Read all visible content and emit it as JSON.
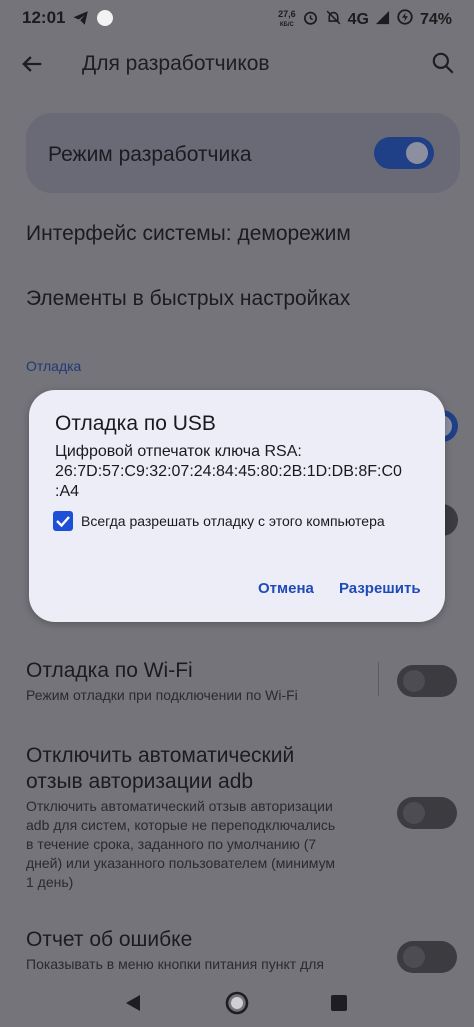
{
  "status_bar": {
    "time": "12:01",
    "speed_value": "27,6",
    "speed_unit": "КБ/С",
    "network": "4G",
    "battery": "74%"
  },
  "header": {
    "title": "Для разработчиков"
  },
  "dev_mode": {
    "label": "Режим разработчика",
    "enabled": true
  },
  "items": {
    "demo_mode": "Интерфейс системы: деморежим",
    "quick_settings": "Элементы в быстрых настройках"
  },
  "section": {
    "debugging": "Отладка"
  },
  "wifi_debug": {
    "title": "Отладка по Wi-Fi",
    "subtitle": "Режим отладки при подключении по Wi-Fi",
    "enabled": false
  },
  "adb_revoke": {
    "title_line1": "Отключить автоматический",
    "title_line2": "отзыв авторизации adb",
    "sub_line1": "Отключить автоматический отзыв авторизации",
    "sub_line2": "adb для систем, которые не переподключались",
    "sub_line3": "в течение срока, заданного по умолчанию (7",
    "sub_line4": "дней) или указанного пользователем (минимум",
    "sub_line5": "1 день)",
    "enabled": false
  },
  "bug_report": {
    "title": "Отчет об ошибке",
    "subtitle": "Показывать в меню кнопки питания пункт для",
    "enabled": false
  },
  "dialog": {
    "title": "Отладка по USB",
    "body_line1": "Цифровой отпечаток ключа RSA:",
    "body_line2": "26:7D:57:C9:32:07:24:84:45:80:2B:1D:DB:8F:C0",
    "body_line3": ":A4",
    "checkbox_label": "Всегда разрешать отладку с этого компьютера",
    "checkbox_checked": true,
    "cancel": "Отмена",
    "allow": "Разрешить"
  },
  "colors": {
    "accent": "#1f4bb8",
    "dialog_bg": "#ededf7",
    "scrim_bg": "#74747a"
  }
}
